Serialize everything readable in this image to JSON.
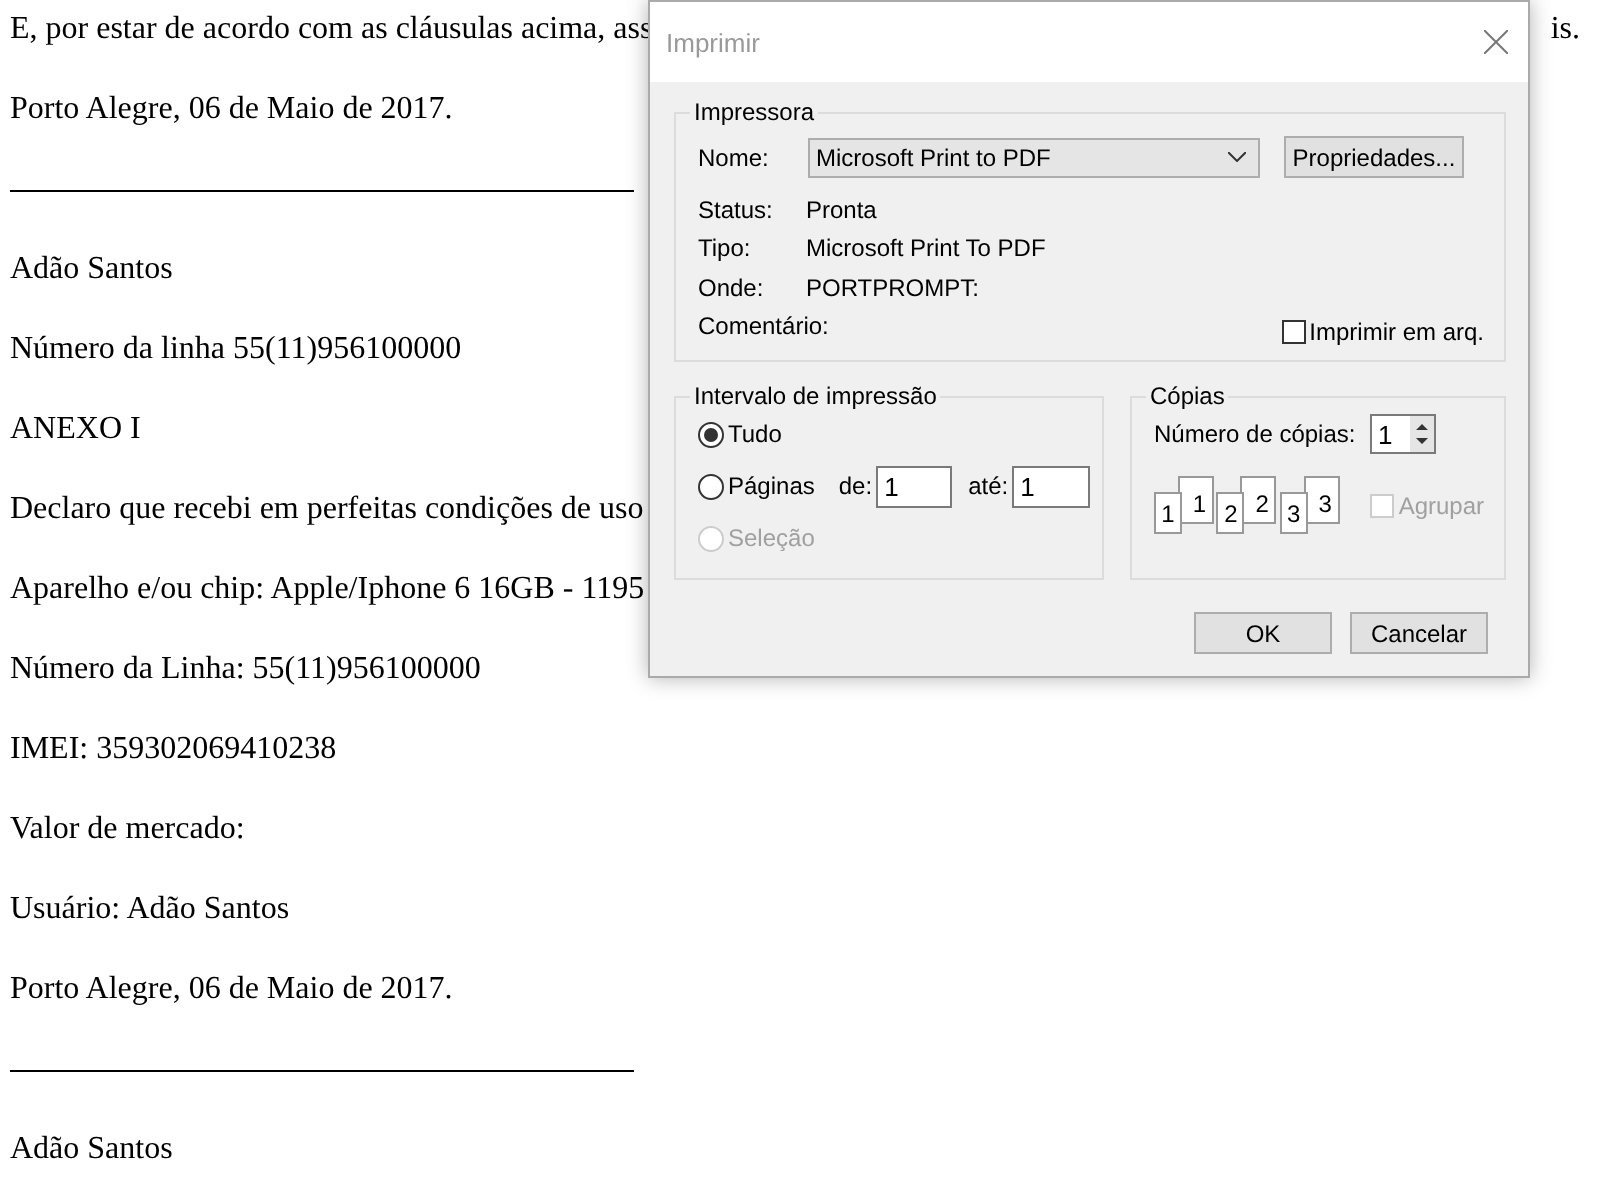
{
  "document": {
    "lines": [
      {
        "kind": "text",
        "text": "E, por estar de acordo com as cláusulas acima, ass",
        "tail": "is."
      },
      {
        "kind": "text",
        "text": "Porto Alegre, 06 de Maio de 2017."
      },
      {
        "kind": "rule"
      },
      {
        "kind": "text",
        "text": "Adão Santos"
      },
      {
        "kind": "text",
        "text": "Número da linha 55(11)956100000"
      },
      {
        "kind": "text",
        "text": "ANEXO I"
      },
      {
        "kind": "text",
        "text": "Declaro que recebi em perfeitas condições de uso"
      },
      {
        "kind": "text",
        "text": "Aparelho e/ou chip: Apple/Iphone 6 16GB - 1195"
      },
      {
        "kind": "text",
        "text": "Número da Linha: 55(11)956100000"
      },
      {
        "kind": "text",
        "text": "IMEI: 359302069410238"
      },
      {
        "kind": "text",
        "text": "Valor de mercado:"
      },
      {
        "kind": "text",
        "text": "Usuário: Adão Santos"
      },
      {
        "kind": "text",
        "text": "Porto Alegre, 06 de Maio de 2017."
      },
      {
        "kind": "rule"
      },
      {
        "kind": "text",
        "text": "Adão Santos"
      }
    ]
  },
  "dialog": {
    "title": "Imprimir",
    "printer": {
      "legend": "Impressora",
      "name_label": "Nome:",
      "name_value": "Microsoft Print to PDF",
      "properties_button": "Propriedades...",
      "info": [
        {
          "label": "Status:",
          "value": "Pronta"
        },
        {
          "label": "Tipo:",
          "value": "Microsoft Print To PDF"
        },
        {
          "label": "Onde:",
          "value": "PORTPROMPT:"
        },
        {
          "label": "Comentário:"
        }
      ],
      "print_to_file": {
        "label": "Imprimir em arq.",
        "checked": false
      }
    },
    "range": {
      "legend": "Intervalo de impressão",
      "options": [
        {
          "kind": "plain",
          "label": "Tudo",
          "selected": true,
          "disabled": false
        },
        {
          "kind": "pages",
          "label": "Páginas",
          "selected": false,
          "disabled": false,
          "from_label": "de:",
          "from_value": "1",
          "to_label": "até:",
          "to_value": "1"
        },
        {
          "kind": "plain",
          "label": "Seleção",
          "selected": false,
          "disabled": true
        }
      ]
    },
    "copies": {
      "legend": "Cópias",
      "count_label": "Número de cópias:",
      "count_value": "1",
      "collate_pages": [
        {
          "back": "1",
          "front": "1"
        },
        {
          "back": "2",
          "front": "2"
        },
        {
          "back": "3",
          "front": "3"
        }
      ],
      "collate": {
        "label": "Agrupar",
        "checked": false,
        "disabled": true
      }
    },
    "buttons": [
      "OK",
      "Cancelar"
    ]
  }
}
